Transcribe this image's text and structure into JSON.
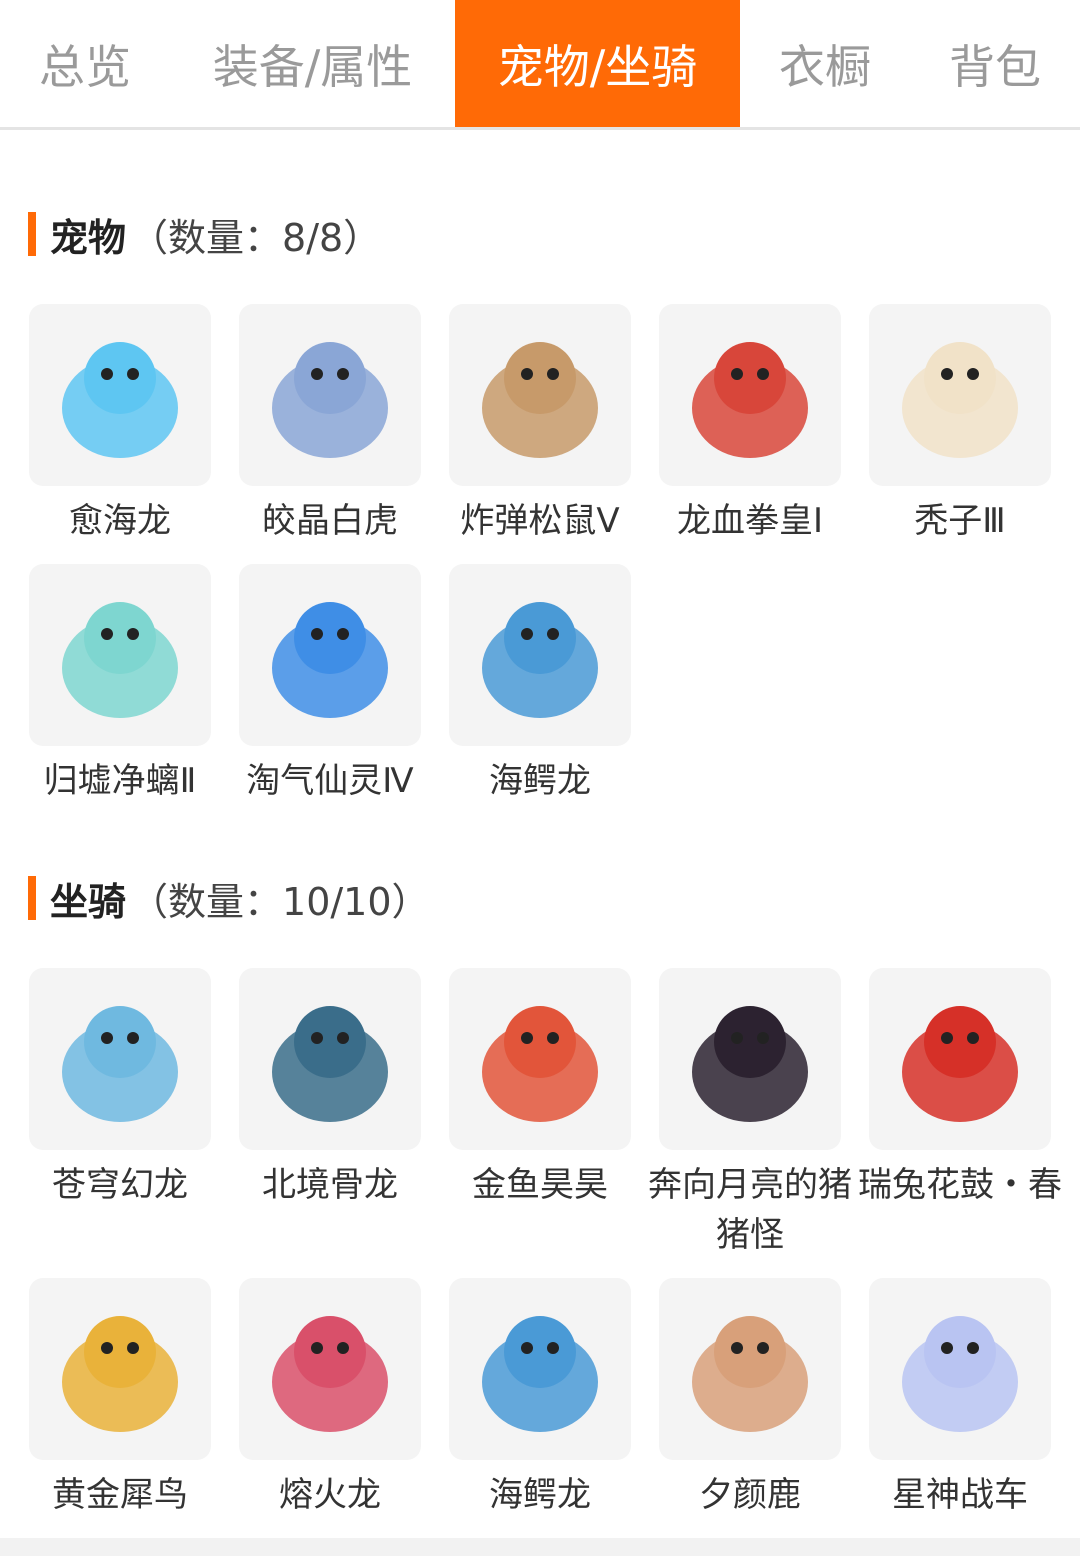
{
  "tabs": [
    {
      "label": "总览"
    },
    {
      "label": "装备/属性"
    },
    {
      "label": "宠物/坐骑"
    },
    {
      "label": "衣橱"
    },
    {
      "label": "背包"
    }
  ],
  "pets": {
    "title": "宠物",
    "count": "（数量：8/8）",
    "items": [
      {
        "label": "愈海龙",
        "icon": "sea-dragon-icon",
        "color": "#5ec6f2"
      },
      {
        "label": "皎晶白虎",
        "icon": "white-tiger-icon",
        "color": "#8aa6d6"
      },
      {
        "label": "炸弹松鼠Ⅴ",
        "icon": "bomb-squirrel-icon",
        "color": "#c79a6a"
      },
      {
        "label": "龙血拳皇Ⅰ",
        "icon": "dragonblood-boxer-icon",
        "color": "#d8463a"
      },
      {
        "label": "秃子Ⅲ",
        "icon": "bald-kid-icon",
        "color": "#f1e2c8"
      },
      {
        "label": "归墟净螭Ⅱ",
        "icon": "jade-dragon-icon",
        "color": "#7ed6d0"
      },
      {
        "label": "淘气仙灵Ⅳ",
        "icon": "blue-pup-icon",
        "color": "#3f8ee6"
      },
      {
        "label": "海鳄龙",
        "icon": "sea-crocodile-dragon-icon",
        "color": "#4a9ad6"
      }
    ]
  },
  "mounts": {
    "title": "坐骑",
    "count": "（数量：10/10）",
    "items": [
      {
        "label": "苍穹幻龙",
        "icon": "sky-dragon-icon",
        "color": "#6fb9e0"
      },
      {
        "label": "北境骨龙",
        "icon": "bone-dragon-icon",
        "color": "#3a6d8a"
      },
      {
        "label": "金鱼昊昊",
        "icon": "goldfish-icon",
        "color": "#e2553a"
      },
      {
        "label": "奔向月亮的猪猪怪",
        "icon": "black-pig-icon",
        "color": "#2c2230"
      },
      {
        "label": "瑞兔花鼓・春",
        "icon": "rabbit-drum-icon",
        "color": "#d63028"
      },
      {
        "label": "黄金犀鸟",
        "icon": "hornbill-icon",
        "color": "#e9b23a"
      },
      {
        "label": "熔火龙",
        "icon": "lava-dragon-icon",
        "color": "#d9506a"
      },
      {
        "label": "海鳄龙",
        "icon": "sea-crocodile-dragon-icon",
        "color": "#4a9ad6"
      },
      {
        "label": "夕颜鹿",
        "icon": "deer-icon",
        "color": "#d8a07a"
      },
      {
        "label": "星神战车",
        "icon": "star-horse-icon",
        "color": "#b9c4f2"
      }
    ]
  }
}
